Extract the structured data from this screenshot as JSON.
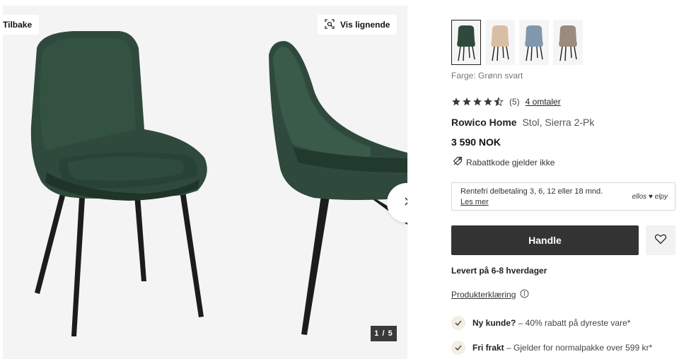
{
  "gallery": {
    "back_label": "Tilbake",
    "similar_label": "Vis lignende",
    "counter": "1 / 5",
    "images": [
      "green-velvet-chair-front",
      "green-velvet-chair-side"
    ]
  },
  "product": {
    "color_options": [
      {
        "name": "Grønn svart",
        "swatch": "#2f4a3c",
        "selected": true
      },
      {
        "name": "Beige",
        "swatch": "#d8bfa4",
        "selected": false
      },
      {
        "name": "Blå",
        "swatch": "#7f98ad",
        "selected": false
      },
      {
        "name": "Brun",
        "swatch": "#9b8a7d",
        "selected": false
      }
    ],
    "color_label": "Farge: Grønn svart",
    "rating": {
      "value": 4.5,
      "max": 5,
      "count": "(5)",
      "reviews_label": "4 omtaler"
    },
    "brand": "Rowico Home",
    "name": "Stol, Sierra 2-Pk",
    "price": "3 590 NOK",
    "discount_note": "Rabattkode gjelder ikke",
    "finance": {
      "text": "Rentefri delbetaling 3, 6, 12 eller 18 mnd.",
      "link": "Les mer",
      "logo": "ellos ♥ elpy"
    },
    "buy_label": "Handle",
    "delivery": "Levert på 6-8 hverdager",
    "declaration_label": "Produkterklæring",
    "perks": [
      {
        "title": "Ny kunde?",
        "text": " – 40% rabatt på dyreste vare*"
      },
      {
        "title": "Fri frakt",
        "text": " – Gjelder for normalpakke over 599 kr*"
      }
    ]
  },
  "colors": {
    "chair_green": "#2f4a3c",
    "chair_dark": "#1f3529",
    "legs": "#1c1c1c",
    "button_dark": "#333333",
    "star": "#3a3a3a",
    "perk_check_bg": "#f3ede4"
  },
  "icons": [
    "scan-icon",
    "chevron-right-icon",
    "star-icon",
    "discount-tag-icon",
    "heart-icon",
    "info-icon",
    "check-icon"
  ]
}
